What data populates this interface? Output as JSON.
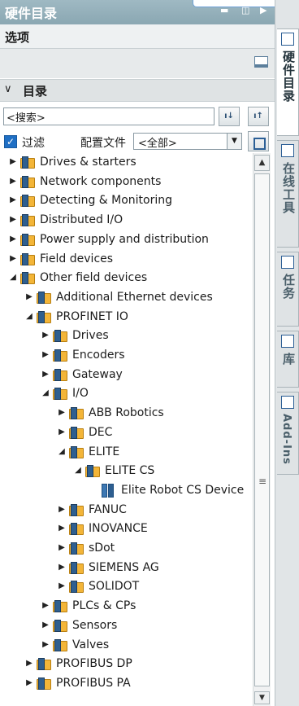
{
  "panel": {
    "title": "硬件目录"
  },
  "options": {
    "label": "选项"
  },
  "catalog": {
    "label": "目录"
  },
  "search": {
    "value": "<搜索>"
  },
  "filter": {
    "label": "过滤",
    "checked": true
  },
  "profile": {
    "label": "配置文件",
    "selected": "<全部>"
  },
  "side_tabs": [
    {
      "label": "硬件目录",
      "icon": "catalog-icon",
      "active": true
    },
    {
      "label": "在线工具",
      "icon": "online-tools-icon",
      "active": false
    },
    {
      "label": "任务",
      "icon": "tasks-icon",
      "active": false
    },
    {
      "label": "库",
      "icon": "libraries-icon",
      "active": false
    },
    {
      "label": "Add-Ins",
      "icon": "addins-icon",
      "active": false
    }
  ],
  "tree": [
    {
      "label": "Drives & starters",
      "depth": 0,
      "state": "collapsed",
      "icon": "folder-icon"
    },
    {
      "label": "Network components",
      "depth": 0,
      "state": "collapsed",
      "icon": "folder-icon"
    },
    {
      "label": "Detecting & Monitoring",
      "depth": 0,
      "state": "collapsed",
      "icon": "folder-icon"
    },
    {
      "label": "Distributed I/O",
      "depth": 0,
      "state": "collapsed",
      "icon": "folder-icon"
    },
    {
      "label": "Power supply and distribution",
      "depth": 0,
      "state": "collapsed",
      "icon": "folder-icon"
    },
    {
      "label": "Field devices",
      "depth": 0,
      "state": "collapsed",
      "icon": "folder-icon"
    },
    {
      "label": "Other field devices",
      "depth": 0,
      "state": "expanded",
      "icon": "folder-icon"
    },
    {
      "label": "Additional Ethernet devices",
      "depth": 1,
      "state": "collapsed",
      "icon": "folder-icon"
    },
    {
      "label": "PROFINET IO",
      "depth": 1,
      "state": "expanded",
      "icon": "folder-icon"
    },
    {
      "label": "Drives",
      "depth": 2,
      "state": "collapsed",
      "icon": "folder-icon"
    },
    {
      "label": "Encoders",
      "depth": 2,
      "state": "collapsed",
      "icon": "folder-icon"
    },
    {
      "label": "Gateway",
      "depth": 2,
      "state": "collapsed",
      "icon": "folder-icon"
    },
    {
      "label": "I/O",
      "depth": 2,
      "state": "expanded",
      "icon": "folder-icon"
    },
    {
      "label": "ABB Robotics",
      "depth": 3,
      "state": "collapsed",
      "icon": "folder-icon"
    },
    {
      "label": "DEC",
      "depth": 3,
      "state": "collapsed",
      "icon": "folder-icon"
    },
    {
      "label": "ELITE",
      "depth": 3,
      "state": "expanded",
      "icon": "folder-icon"
    },
    {
      "label": "ELITE CS",
      "depth": 4,
      "state": "expanded",
      "icon": "folder-icon"
    },
    {
      "label": "Elite Robot CS Device",
      "depth": 5,
      "state": "leaf",
      "icon": "device-icon"
    },
    {
      "label": "FANUC",
      "depth": 3,
      "state": "collapsed",
      "icon": "folder-icon"
    },
    {
      "label": "INOVANCE",
      "depth": 3,
      "state": "collapsed",
      "icon": "folder-icon"
    },
    {
      "label": "sDot",
      "depth": 3,
      "state": "collapsed",
      "icon": "folder-icon"
    },
    {
      "label": "SIEMENS AG",
      "depth": 3,
      "state": "collapsed",
      "icon": "folder-icon"
    },
    {
      "label": "SOLIDOT",
      "depth": 3,
      "state": "collapsed",
      "icon": "folder-icon"
    },
    {
      "label": "PLCs & CPs",
      "depth": 2,
      "state": "collapsed",
      "icon": "folder-icon"
    },
    {
      "label": "Sensors",
      "depth": 2,
      "state": "collapsed",
      "icon": "folder-icon"
    },
    {
      "label": "Valves",
      "depth": 2,
      "state": "collapsed",
      "icon": "folder-icon"
    },
    {
      "label": "PROFIBUS DP",
      "depth": 1,
      "state": "collapsed",
      "icon": "folder-icon"
    },
    {
      "label": "PROFIBUS PA",
      "depth": 1,
      "state": "collapsed",
      "icon": "folder-icon"
    }
  ]
}
